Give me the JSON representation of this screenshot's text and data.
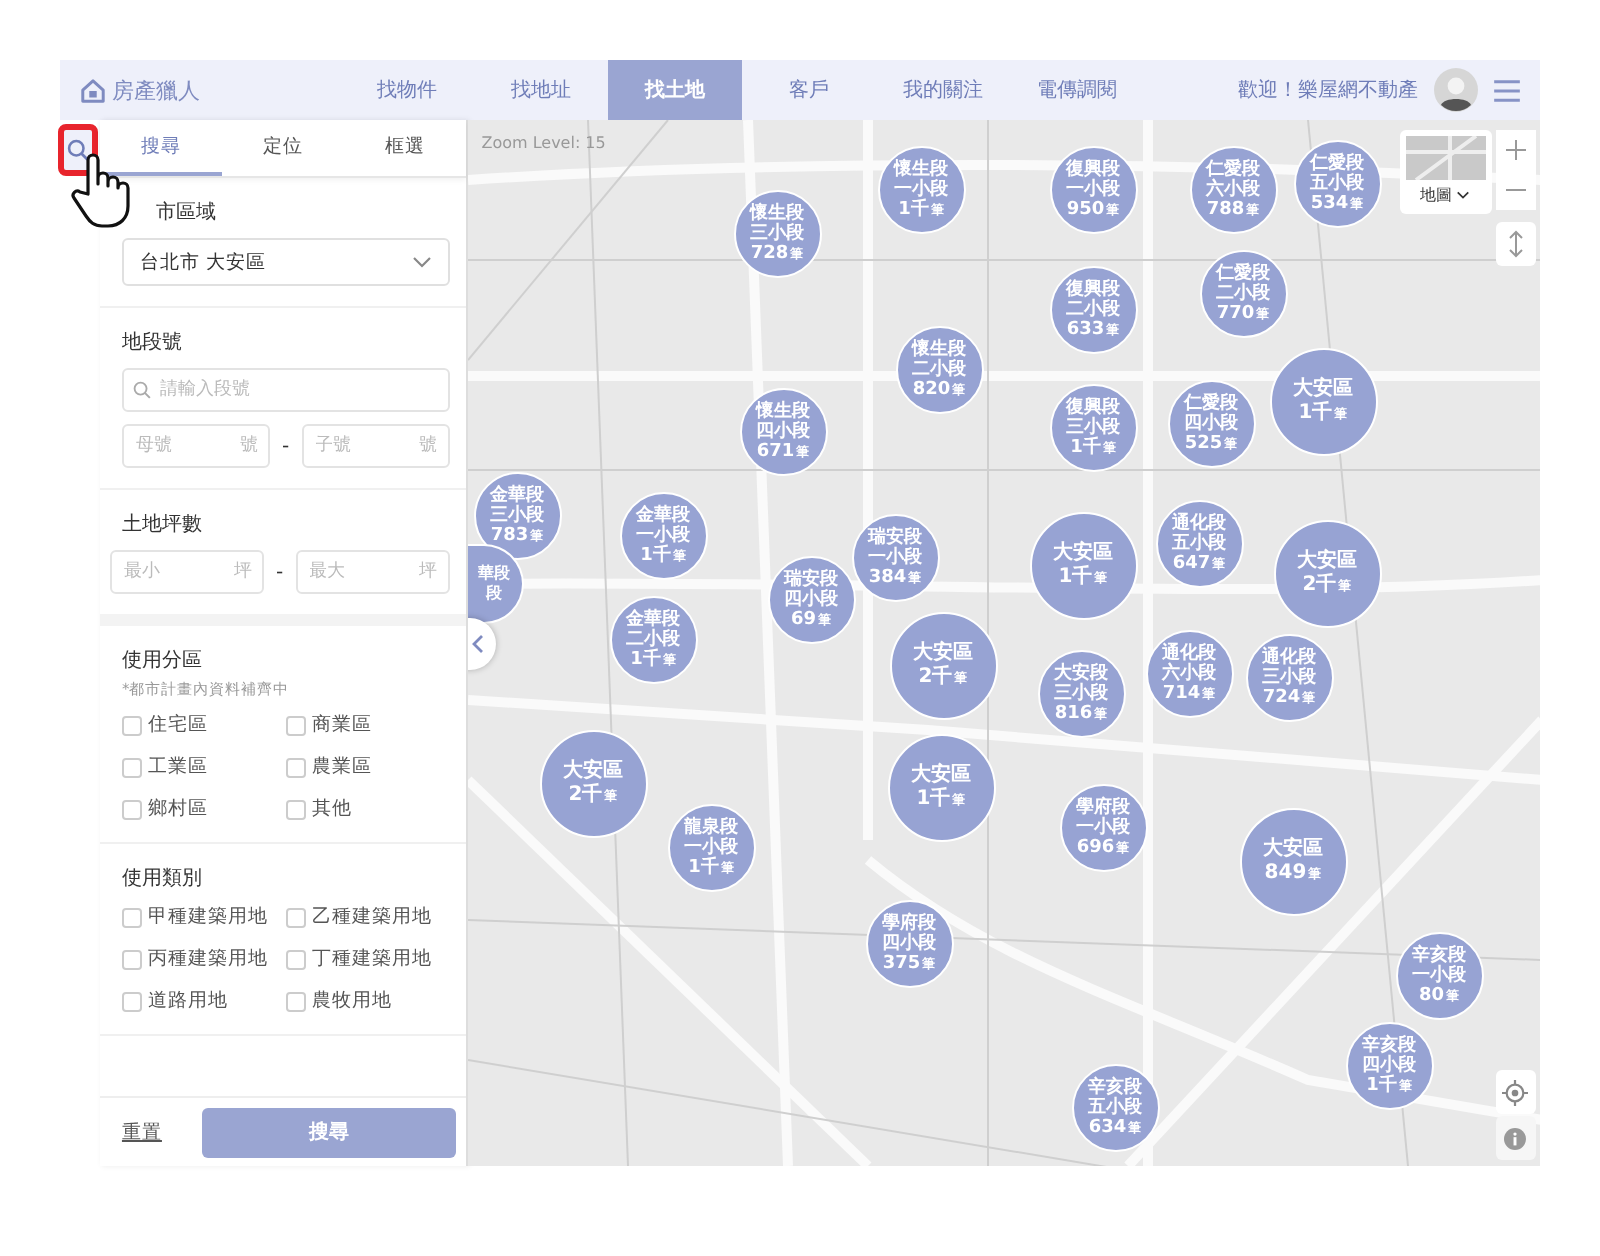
{
  "header": {
    "logo": "房產獵人",
    "nav": [
      {
        "label": "找物件",
        "selected": false
      },
      {
        "label": "找地址",
        "selected": false
      },
      {
        "label": "找土地",
        "selected": true
      },
      {
        "label": "客戶",
        "selected": false
      },
      {
        "label": "我的關注",
        "selected": false
      },
      {
        "label": "電傳調閱",
        "selected": false
      }
    ],
    "welcome": "歡迎！樂屋網不動產"
  },
  "sidebar": {
    "tabs": [
      {
        "label": "搜尋",
        "selected": true
      },
      {
        "label": "定位",
        "selected": false
      },
      {
        "label": "框選",
        "selected": false
      }
    ],
    "city": {
      "label": "市區域",
      "value": "台北市 大安區"
    },
    "lot": {
      "label": "地段號",
      "placeholder": "請輸入段號",
      "mother": {
        "placeholder": "母號",
        "unit": "號"
      },
      "separator": "-",
      "child": {
        "placeholder": "子號",
        "unit": "號"
      }
    },
    "area": {
      "label": "土地坪數",
      "min": {
        "placeholder": "最小",
        "unit": "坪"
      },
      "separator": "-",
      "max": {
        "placeholder": "最大",
        "unit": "坪"
      }
    },
    "zoning": {
      "label": "使用分區",
      "note": "*都市計畫內資料補齊中",
      "options": [
        {
          "label": "住宅區",
          "checked": false
        },
        {
          "label": "商業區",
          "checked": false
        },
        {
          "label": "工業區",
          "checked": false
        },
        {
          "label": "農業區",
          "checked": false
        },
        {
          "label": "鄉村區",
          "checked": false
        },
        {
          "label": "其他",
          "checked": false
        }
      ]
    },
    "category": {
      "label": "使用類別",
      "options": [
        {
          "label": "甲種建築用地",
          "checked": false
        },
        {
          "label": "乙種建築用地",
          "checked": false
        },
        {
          "label": "丙種建築用地",
          "checked": false
        },
        {
          "label": "丁種建築用地",
          "checked": false
        },
        {
          "label": "道路用地",
          "checked": false
        },
        {
          "label": "農牧用地",
          "checked": false
        }
      ]
    },
    "reset": "重置",
    "submit": "搜尋"
  },
  "map": {
    "zoom_level": "Zoom Level: 15",
    "layer_label": "地圖",
    "clusters": [
      {
        "kind": "section",
        "lines": [
          "懷生段",
          "一小段"
        ],
        "count": "1千",
        "unit": "筆"
      },
      {
        "kind": "section",
        "lines": [
          "復興段",
          "一小段"
        ],
        "count": "950",
        "unit": "筆"
      },
      {
        "kind": "section",
        "lines": [
          "仁愛段",
          "六小段"
        ],
        "count": "788",
        "unit": "筆"
      },
      {
        "kind": "section",
        "lines": [
          "仁愛段",
          "五小段"
        ],
        "count": "534",
        "unit": "筆"
      },
      {
        "kind": "section",
        "lines": [
          "懷生段",
          "三小段"
        ],
        "count": "728",
        "unit": "筆"
      },
      {
        "kind": "section",
        "lines": [
          "仁愛段",
          "二小段"
        ],
        "count": "770",
        "unit": "筆"
      },
      {
        "kind": "section",
        "lines": [
          "復興段",
          "二小段"
        ],
        "count": "633",
        "unit": "筆"
      },
      {
        "kind": "section",
        "lines": [
          "懷生段",
          "二小段"
        ],
        "count": "820",
        "unit": "筆"
      },
      {
        "kind": "district",
        "lines": [
          "大安區"
        ],
        "count": "1千",
        "unit": "筆"
      },
      {
        "kind": "section",
        "lines": [
          "懷生段",
          "四小段"
        ],
        "count": "671",
        "unit": "筆"
      },
      {
        "kind": "section",
        "lines": [
          "復興段",
          "三小段"
        ],
        "count": "1千",
        "unit": "筆"
      },
      {
        "kind": "section",
        "lines": [
          "仁愛段",
          "四小段"
        ],
        "count": "525",
        "unit": "筆"
      },
      {
        "kind": "section",
        "lines": [
          "金華段",
          "三小段"
        ],
        "count": "783",
        "unit": "筆"
      },
      {
        "kind": "section",
        "lines": [
          "金華段",
          "一小段"
        ],
        "count": "1千",
        "unit": "筆"
      },
      {
        "kind": "section",
        "lines": [
          "瑞安段",
          "一小段"
        ],
        "count": "384",
        "unit": "筆"
      },
      {
        "kind": "district",
        "lines": [
          "大安區"
        ],
        "count": "1千",
        "unit": "筆"
      },
      {
        "kind": "section",
        "lines": [
          "通化段",
          "五小段"
        ],
        "count": "647",
        "unit": "筆"
      },
      {
        "kind": "district",
        "lines": [
          "大安區"
        ],
        "count": "2千",
        "unit": "筆"
      },
      {
        "kind": "partial",
        "lines": [
          "華段",
          "段"
        ]
      },
      {
        "kind": "section",
        "lines": [
          "瑞安段",
          "四小段"
        ],
        "count": "69",
        "unit": "筆"
      },
      {
        "kind": "section",
        "lines": [
          "金華段",
          "二小段"
        ],
        "count": "1千",
        "unit": "筆"
      },
      {
        "kind": "district",
        "lines": [
          "大安區"
        ],
        "count": "2千",
        "unit": "筆"
      },
      {
        "kind": "section",
        "lines": [
          "大安段",
          "三小段"
        ],
        "count": "816",
        "unit": "筆"
      },
      {
        "kind": "section",
        "lines": [
          "通化段",
          "六小段"
        ],
        "count": "714",
        "unit": "筆"
      },
      {
        "kind": "section",
        "lines": [
          "通化段",
          "三小段"
        ],
        "count": "724",
        "unit": "筆"
      },
      {
        "kind": "district",
        "lines": [
          "大安區"
        ],
        "count": "2千",
        "unit": "筆"
      },
      {
        "kind": "district",
        "lines": [
          "大安區"
        ],
        "count": "1千",
        "unit": "筆"
      },
      {
        "kind": "section",
        "lines": [
          "龍泉段",
          "一小段"
        ],
        "count": "1千",
        "unit": "筆"
      },
      {
        "kind": "section",
        "lines": [
          "學府段",
          "一小段"
        ],
        "count": "696",
        "unit": "筆"
      },
      {
        "kind": "district",
        "lines": [
          "大安區"
        ],
        "count": "849",
        "unit": "筆"
      },
      {
        "kind": "section",
        "lines": [
          "學府段",
          "四小段"
        ],
        "count": "375",
        "unit": "筆"
      },
      {
        "kind": "section",
        "lines": [
          "辛亥段",
          "一小段"
        ],
        "count": "80",
        "unit": "筆"
      },
      {
        "kind": "section",
        "lines": [
          "辛亥段",
          "四小段"
        ],
        "count": "1千",
        "unit": "筆"
      },
      {
        "kind": "section",
        "lines": [
          "辛亥段",
          "五小段"
        ],
        "count": "634",
        "unit": "筆"
      }
    ]
  }
}
